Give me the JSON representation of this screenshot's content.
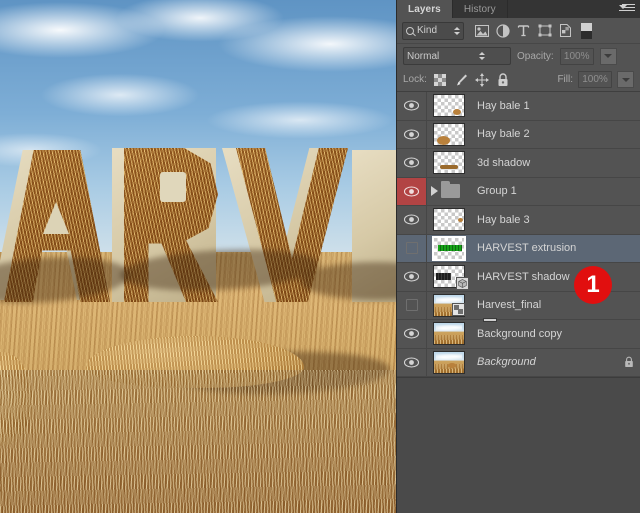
{
  "panel": {
    "tabs": [
      {
        "label": "Layers",
        "active": true
      },
      {
        "label": "History",
        "active": false
      }
    ],
    "menu_icon": "panel-menu-icon",
    "filter": {
      "search_icon": "search-icon",
      "kind_label": "Kind",
      "type_filters": [
        {
          "name": "filter-pixel-layers-icon",
          "title": "Pixel layers"
        },
        {
          "name": "filter-adjustment-layers-icon",
          "title": "Adjustment layers"
        },
        {
          "name": "filter-type-layers-icon",
          "title": "Type layers"
        },
        {
          "name": "filter-shape-layers-icon",
          "title": "Shape layers"
        },
        {
          "name": "filter-smart-objects-icon",
          "title": "Smart objects"
        }
      ],
      "toggle_icon": "filter-toggle-switch-icon"
    },
    "blend": {
      "mode_value": "Normal",
      "opacity_label": "Opacity:",
      "opacity_value": "100%"
    },
    "lock": {
      "label": "Lock:",
      "icons": [
        {
          "name": "lock-transparent-pixels-icon"
        },
        {
          "name": "lock-image-pixels-icon"
        },
        {
          "name": "lock-position-icon"
        },
        {
          "name": "lock-all-icon"
        }
      ],
      "fill_label": "Fill:",
      "fill_value": "100%"
    },
    "layers": [
      {
        "name": "Hay bale 1",
        "visible": true,
        "selected": false,
        "kind": "transparent",
        "thumb": "hay-bale-small",
        "locked": false,
        "eye_highlighted": false
      },
      {
        "name": "Hay bale 2",
        "visible": true,
        "selected": false,
        "kind": "transparent",
        "thumb": "hay-bale-medium",
        "locked": false,
        "eye_highlighted": false
      },
      {
        "name": "3d shadow",
        "visible": true,
        "selected": false,
        "kind": "transparent",
        "thumb": "shadow-streak",
        "locked": false,
        "eye_highlighted": false
      },
      {
        "name": "Group 1",
        "visible": true,
        "selected": false,
        "kind": "group",
        "thumb": "folder",
        "locked": false,
        "eye_highlighted": true
      },
      {
        "name": "Hay bale 3",
        "visible": true,
        "selected": false,
        "kind": "transparent",
        "thumb": "hay-bale-tiny",
        "locked": false,
        "eye_highlighted": false
      },
      {
        "name": "HARVEST extrusion",
        "visible": false,
        "selected": true,
        "kind": "transparent",
        "thumb": "green-text",
        "locked": false,
        "eye_highlighted": false
      },
      {
        "name": "HARVEST shadow",
        "visible": true,
        "selected": false,
        "kind": "transparent-3d",
        "thumb": "dark-text-3d",
        "locked": false,
        "eye_highlighted": false
      },
      {
        "name": "Harvest_final",
        "visible": false,
        "selected": false,
        "kind": "smart-object",
        "thumb": "field-photo",
        "locked": false,
        "eye_highlighted": false,
        "drop_indicator": true
      },
      {
        "name": "Background copy",
        "visible": true,
        "selected": false,
        "kind": "photo",
        "thumb": "field-photo",
        "locked": false,
        "eye_highlighted": false
      },
      {
        "name": "Background",
        "visible": true,
        "selected": false,
        "kind": "photo",
        "thumb": "field-photo",
        "locked": true,
        "italic": true,
        "eye_highlighted": false
      }
    ]
  },
  "annotation": {
    "badge_number": "1",
    "badge_color": "#e10f0f"
  },
  "canvas": {
    "artwork_text": "ARV",
    "description": "hay-letters-field-composite"
  },
  "colors": {
    "panel_bg": "#535353",
    "tab_bg": "#343434",
    "selected_row": "#5c6775",
    "eye_highlight_red": "#b24444",
    "text": "#d4d4d4",
    "muted_text": "#8f8f8f"
  }
}
